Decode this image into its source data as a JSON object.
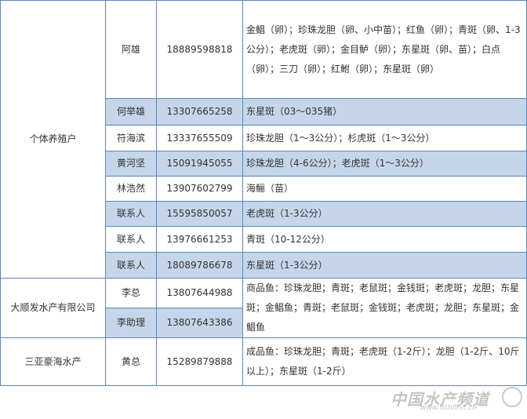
{
  "rows": [
    {
      "org": "个体养殖户",
      "name": "阿雄",
      "phone": "18889598818",
      "product": "金鲳（卵）；珍珠龙胆（卵、小中苗）；红鱼（卵）；青斑（卵、1-3公分）；老虎斑（卵）；金目鲈（卵）；东星斑（卵、苗）；白点（卵）；三刀（卵）；红鲋（卵）；东星斑（卵）"
    },
    {
      "name": "何举雄",
      "phone": "13307665258",
      "product": "东星斑（03～035猪）"
    },
    {
      "name": "符海滨",
      "phone": "13337655509",
      "product": "珍珠龙胆（1～3公分）；杉虎斑（1～3公分）"
    },
    {
      "name": "黄河坚",
      "phone": "15091945055",
      "product": "珍珠龙胆（4-6公分）；老虎斑（1～3公分）"
    },
    {
      "name": "林浩然",
      "phone": "13907602799",
      "product": "海鲡（苗）"
    },
    {
      "name": "联系人",
      "phone": "15595850057",
      "product": "老虎斑（1-3公分）"
    },
    {
      "name": "联系人",
      "phone": "13976661253",
      "product": "青斑（10-12公分）"
    },
    {
      "name": "联系人",
      "phone": "18089786678",
      "product": "东星斑（1-3公分）"
    },
    {
      "org": "大顺发水产有限公司",
      "name": "李总",
      "phone": "13807644988",
      "product": "商品鱼：珍珠龙胆；青斑；老鼠斑；金钱斑；老虎斑；龙胆；东星斑；金鲳鱼；青斑；老鼠斑；金钱斑；老虎斑；龙胆；东星斑；金鲳鱼"
    },
    {
      "name": "李助理",
      "phone": "13807643386"
    },
    {
      "org": "三亚豪海水产",
      "name": "黄总",
      "phone": "15289879888",
      "product": "成品鱼：珍珠龙胆；青斑；老虎斑（1-2斤）；龙胆（1-2斤、10斤以上）；东星斑（1-2斤）"
    }
  ],
  "watermark": {
    "brand": "中国水产频道",
    "site": "www.fishfirst.cn"
  }
}
